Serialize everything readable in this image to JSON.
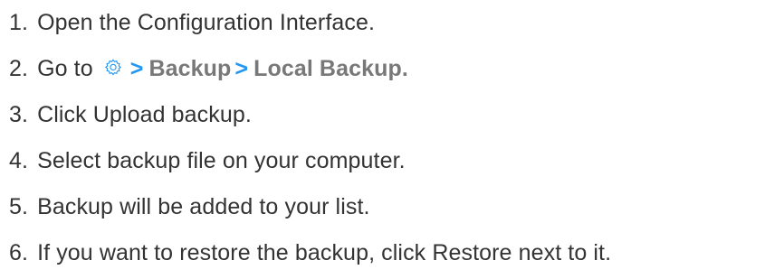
{
  "steps": [
    {
      "number": "1.",
      "text": "Open the Configuration Interface."
    },
    {
      "number": "2.",
      "prefix": "Go to",
      "icon": "gear-icon",
      "separator": ">",
      "crumb1": "Backup",
      "crumb2": "Local Backup."
    },
    {
      "number": "3.",
      "text": "Click Upload backup."
    },
    {
      "number": "4.",
      "text": "Select backup file on your computer."
    },
    {
      "number": "5.",
      "text": "Backup will be added to your list."
    },
    {
      "number": "6.",
      "text": "If you want to restore the backup, click Restore next to it."
    }
  ],
  "colors": {
    "text": "#333333",
    "accent": "#2196f3",
    "crumb": "#787878"
  }
}
